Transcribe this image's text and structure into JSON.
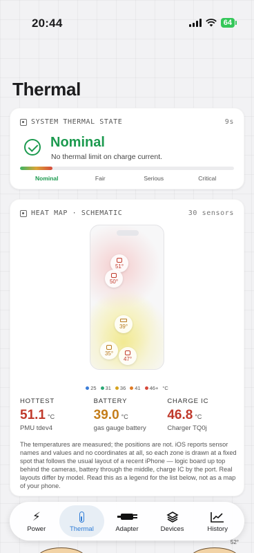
{
  "status_bar": {
    "time": "20:44",
    "battery": "64"
  },
  "page_title": "Thermal",
  "thermal_state": {
    "header": "SYSTEM THERMAL STATE",
    "age": "9s",
    "value": "Nominal",
    "description": "No thermal limit on charge current.",
    "level_fraction": 0.15,
    "levels": [
      "Nominal",
      "Fair",
      "Serious",
      "Critical"
    ],
    "color": "#1c9a4f"
  },
  "heat_map": {
    "header": "HEAT MAP · SCHEMATIC",
    "sensor_count": "30 sensors",
    "sensors": [
      {
        "label": "51°",
        "icon": "chip-icon",
        "color": "#c0392b"
      },
      {
        "label": "50°",
        "icon": "chip-icon",
        "color": "#c0392b"
      },
      {
        "label": "39°",
        "icon": "battery-icon",
        "color": "#b7791f"
      },
      {
        "label": "35°",
        "icon": "charger-icon",
        "color": "#b7791f"
      },
      {
        "label": "47°",
        "icon": "chip-icon",
        "color": "#c0392b"
      }
    ],
    "legend": [
      {
        "label": "25",
        "color": "#3b7dd8"
      },
      {
        "label": "31",
        "color": "#2aa876"
      },
      {
        "label": "36",
        "color": "#d6a31f"
      },
      {
        "label": "41",
        "color": "#e07b24"
      },
      {
        "label": "46+",
        "color": "#d6483a"
      }
    ],
    "legend_unit": "°C"
  },
  "stats": [
    {
      "label": "HOTTEST",
      "value": "51.1",
      "unit": "°C",
      "sub": "PMU tdev4",
      "color": "#c0392b"
    },
    {
      "label": "BATTERY",
      "value": "39.0",
      "unit": "°C",
      "sub": "gas gauge battery",
      "color": "#c47d1a"
    },
    {
      "label": "CHARGE IC",
      "value": "46.8",
      "unit": "°C",
      "sub": "Charger TQ0j",
      "color": "#c0392b"
    }
  ],
  "note": "The temperatures are measured; the positions are not. iOS reports sensor names and values and no coordinates at all, so each zone is drawn at a fixed spot that follows the usual layout of a recent iPhone — logic board up top behind the cameras, battery through the middle, charge IC by the port. Real layouts differ by model. Read this as a legend for the list below, not as a map of your phone.",
  "tabs": [
    {
      "label": "Power",
      "icon": "bolt-icon"
    },
    {
      "label": "Thermal",
      "icon": "thermometer-icon",
      "active": true
    },
    {
      "label": "Adapter",
      "icon": "plug-icon"
    },
    {
      "label": "Devices",
      "icon": "layers-icon"
    },
    {
      "label": "History",
      "icon": "chart-icon"
    }
  ],
  "peek": {
    "value": "52°"
  }
}
